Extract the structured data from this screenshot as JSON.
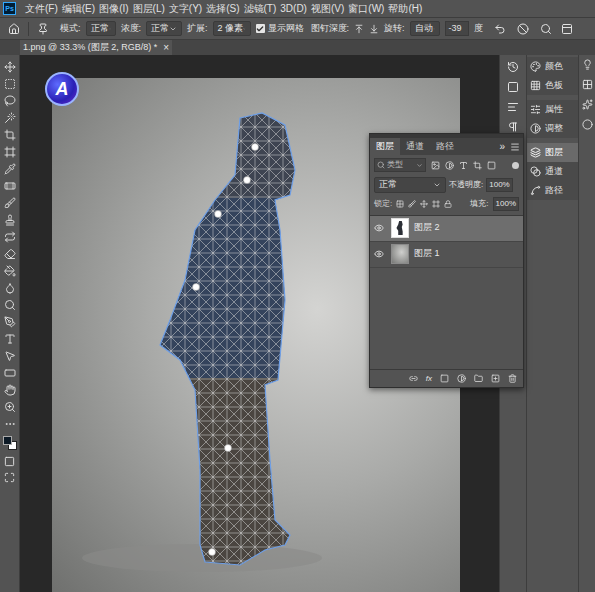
{
  "app": {
    "logo": "Ps"
  },
  "menu": [
    "文件(F)",
    "编辑(E)",
    "图像(I)",
    "图层(L)",
    "文字(Y)",
    "选择(S)",
    "滤镜(T)",
    "3D(D)",
    "视图(V)",
    "窗口(W)",
    "帮助(H)"
  ],
  "options_bar": {
    "mode_label": "模式:",
    "mode": "正常",
    "density_label": "浓度:",
    "density": "正常",
    "expand_label": "扩展:",
    "expand": "2 像素",
    "show_mesh": {
      "label": "显示网格",
      "checked": true
    },
    "pin_depth_label": "图钉深度:",
    "rotate_label": "旋转:",
    "rotate": "自动",
    "angle": "-39",
    "angle_unit": "度"
  },
  "document_tab": {
    "title": "1.png @ 33.3% (图层 2, RGB/8) *",
    "close": "×"
  },
  "watermark": "A",
  "layers_panel": {
    "tabs": [
      {
        "label": "图层",
        "selected": true
      },
      {
        "label": "通道",
        "selected": false
      },
      {
        "label": "路径",
        "selected": false
      }
    ],
    "collapse": "»",
    "filter": {
      "placeholder": "类型"
    },
    "blend_mode": "正常",
    "opacity_label": "不透明度:",
    "opacity": "100%",
    "lock_label": "锁定:",
    "fill_label": "填充:",
    "fill": "100%",
    "layers": [
      {
        "name": "图层 2",
        "selected": true,
        "visible": true
      },
      {
        "name": "图层 1",
        "selected": false,
        "visible": true
      }
    ],
    "fx": "fx"
  },
  "dock": [
    [
      {
        "label": "颜色",
        "selected": false
      },
      {
        "label": "色板",
        "selected": false
      }
    ],
    [
      {
        "label": "属性",
        "selected": false
      },
      {
        "label": "调整",
        "selected": false
      }
    ],
    [
      {
        "label": "图层",
        "selected": true
      },
      {
        "label": "通道",
        "selected": false
      },
      {
        "label": "路径",
        "selected": false
      }
    ]
  ]
}
